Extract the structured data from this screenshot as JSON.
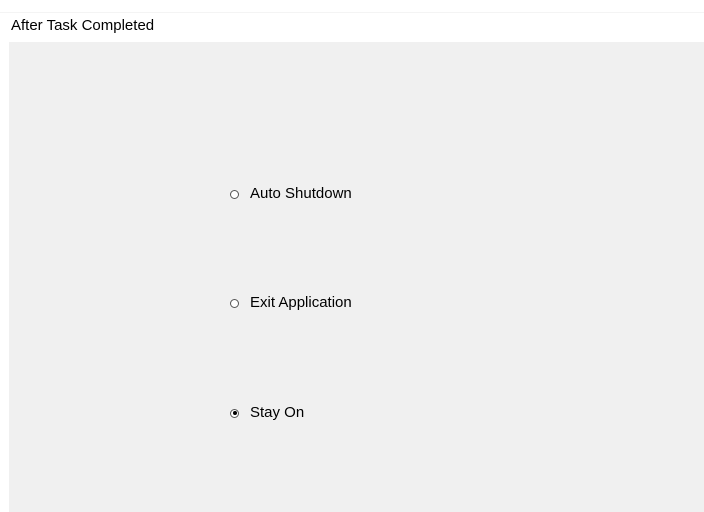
{
  "header": {
    "title": "After Task Completed"
  },
  "options": [
    {
      "label": "Auto Shutdown",
      "selected": false
    },
    {
      "label": "Exit Application",
      "selected": false
    },
    {
      "label": "Stay On",
      "selected": true
    }
  ]
}
